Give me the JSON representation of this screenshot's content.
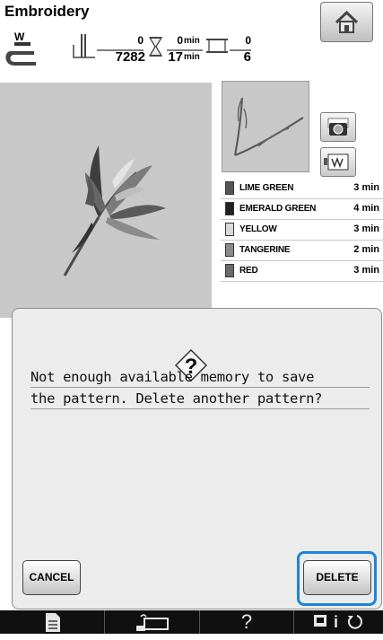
{
  "header": {
    "title": "Embroidery",
    "presser_foot_letter": "W",
    "stitch_current": "0",
    "stitch_total": "7282",
    "time_current": "0",
    "time_total": "17",
    "time_unit": "min",
    "color_current": "0",
    "color_total": "6"
  },
  "threads": [
    {
      "name": "LIME GREEN",
      "time": "3 min",
      "color": "#555555"
    },
    {
      "name": "EMERALD GREEN",
      "time": "4 min",
      "color": "#222222"
    },
    {
      "name": "YELLOW",
      "time": "3 min",
      "color": "#d9d9d9"
    },
    {
      "name": "TANGERINE",
      "time": "2 min",
      "color": "#8a8a8a"
    },
    {
      "name": "RED",
      "time": "3 min",
      "color": "#6a6a6a"
    }
  ],
  "dialog": {
    "line1": "Not enough available memory to save",
    "line2": "the pattern. Delete another pattern?",
    "cancel_label": "CANCEL",
    "delete_label": "DELETE",
    "question_icon": "question-icon"
  },
  "bottombar": {
    "help_label": "?",
    "info_label": "i"
  },
  "colors": {
    "highlight": "#1f84d8",
    "preview_bg": "#c8c8c8",
    "dialog_bg": "#ececec",
    "bottombar_bg": "#101010"
  }
}
